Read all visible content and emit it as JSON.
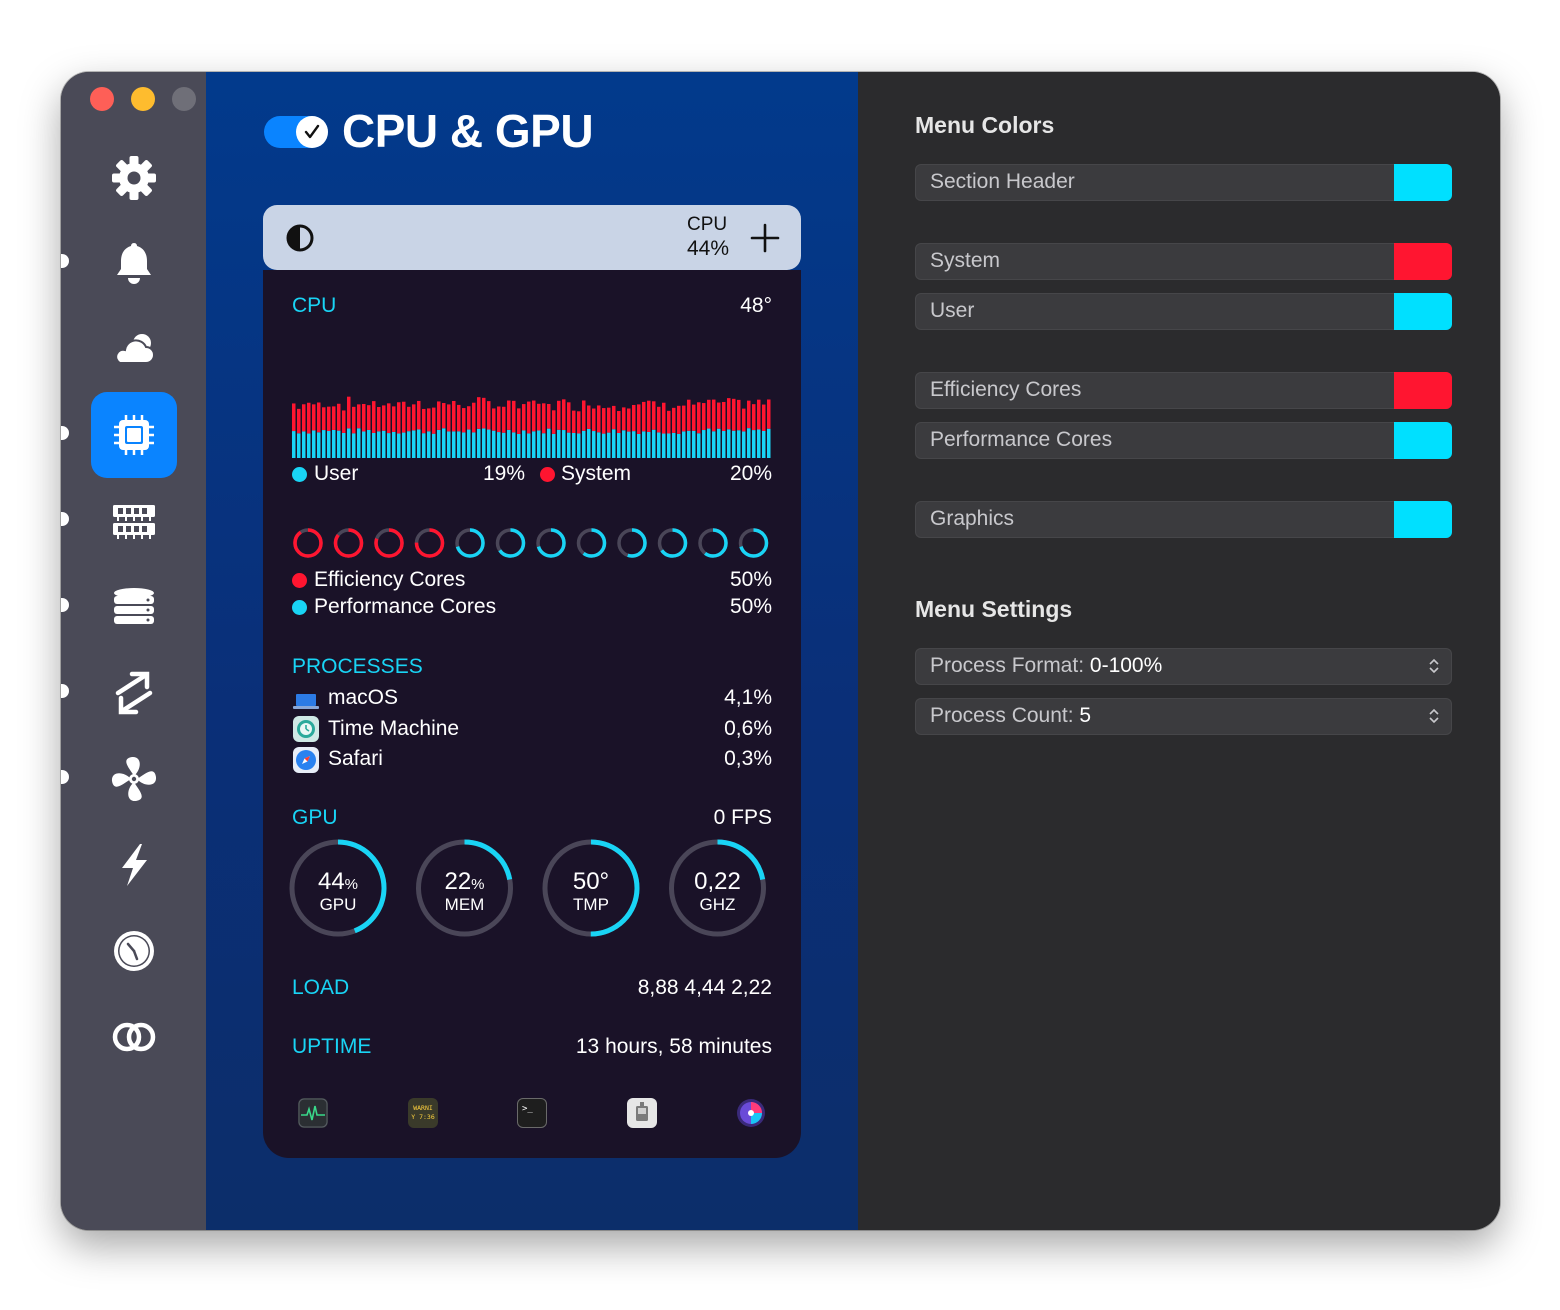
{
  "window": {
    "title": "CPU & GPU",
    "module_enabled": true
  },
  "sidebar": {
    "items": [
      {
        "icon": "gear-icon",
        "label": "General",
        "active": false
      },
      {
        "icon": "bell-icon",
        "label": "Notifications",
        "active": false
      },
      {
        "icon": "cloud-icon",
        "label": "Weather",
        "active": false
      },
      {
        "icon": "cpu-icon",
        "label": "CPU & GPU",
        "active": true
      },
      {
        "icon": "memory-icon",
        "label": "Memory",
        "active": false
      },
      {
        "icon": "disk-icon",
        "label": "Disk",
        "active": false
      },
      {
        "icon": "network-icon",
        "label": "Network",
        "active": false
      },
      {
        "icon": "fan-icon",
        "label": "Sensors",
        "active": false
      },
      {
        "icon": "bolt-icon",
        "label": "Battery",
        "active": false
      },
      {
        "icon": "clock-icon",
        "label": "Time",
        "active": false
      },
      {
        "icon": "link-icon",
        "label": "Link",
        "active": false
      }
    ]
  },
  "menubar": {
    "label": "CPU",
    "value": "44%"
  },
  "panel": {
    "cpu": {
      "title": "CPU",
      "temp": "48°",
      "user_label": "User",
      "user_value": "19%",
      "system_label": "System",
      "system_value": "20%"
    },
    "cores": {
      "efficiency_label": "Efficiency Cores",
      "efficiency_value": "50%",
      "performance_label": "Performance Cores",
      "performance_value": "50%",
      "levels": [
        0.9,
        0.85,
        0.8,
        0.75,
        0.7,
        0.65,
        0.7,
        0.6,
        0.55,
        0.65,
        0.6,
        0.7
      ]
    },
    "processes": {
      "title": "PROCESSES",
      "items": [
        {
          "name": "macOS",
          "value": "4,1%",
          "icon": "laptop-icon"
        },
        {
          "name": "Time Machine",
          "value": "0,6%",
          "icon": "time-machine-icon"
        },
        {
          "name": "Safari",
          "value": "0,3%",
          "icon": "safari-icon"
        }
      ]
    },
    "gpu": {
      "title": "GPU",
      "fps": "0 FPS",
      "gauges": [
        {
          "value": "44",
          "unit": "%",
          "label": "GPU",
          "fraction": 0.44
        },
        {
          "value": "22",
          "unit": "%",
          "label": "MEM",
          "fraction": 0.22
        },
        {
          "value": "50°",
          "unit": "",
          "label": "TMP",
          "fraction": 0.5
        },
        {
          "value": "0,22",
          "unit": "",
          "label": "GHZ",
          "fraction": 0.22
        }
      ]
    },
    "load": {
      "title": "LOAD",
      "value": "8,88 4,44 2,22"
    },
    "uptime": {
      "title": "UPTIME",
      "value": "13 hours, 58 minutes"
    },
    "dock": [
      {
        "icon": "activity-monitor-icon"
      },
      {
        "icon": "console-icon",
        "text1": "WARNI",
        "text2": "Y 7:36"
      },
      {
        "icon": "terminal-icon",
        "text1": ">_"
      },
      {
        "icon": "system-info-icon"
      },
      {
        "icon": "disk-utility-icon"
      }
    ]
  },
  "settings": {
    "menu_colors_title": "Menu Colors",
    "colors": [
      {
        "label": "Section Header",
        "color": "#00e0ff"
      },
      {
        "label": "System",
        "color": "#ff1530"
      },
      {
        "label": "User",
        "color": "#00e0ff"
      },
      {
        "label": "Efficiency Cores",
        "color": "#ff1530"
      },
      {
        "label": "Performance Cores",
        "color": "#00e0ff"
      },
      {
        "label": "Graphics",
        "color": "#00e0ff"
      }
    ],
    "menu_settings_title": "Menu Settings",
    "process_format_label": "Process Format:",
    "process_format_value": "0-100%",
    "process_count_label": "Process Count:",
    "process_count_value": "5"
  },
  "colors": {
    "accent": "#0a84ff",
    "cyan": "#19d4f5",
    "red": "#ff1530"
  }
}
